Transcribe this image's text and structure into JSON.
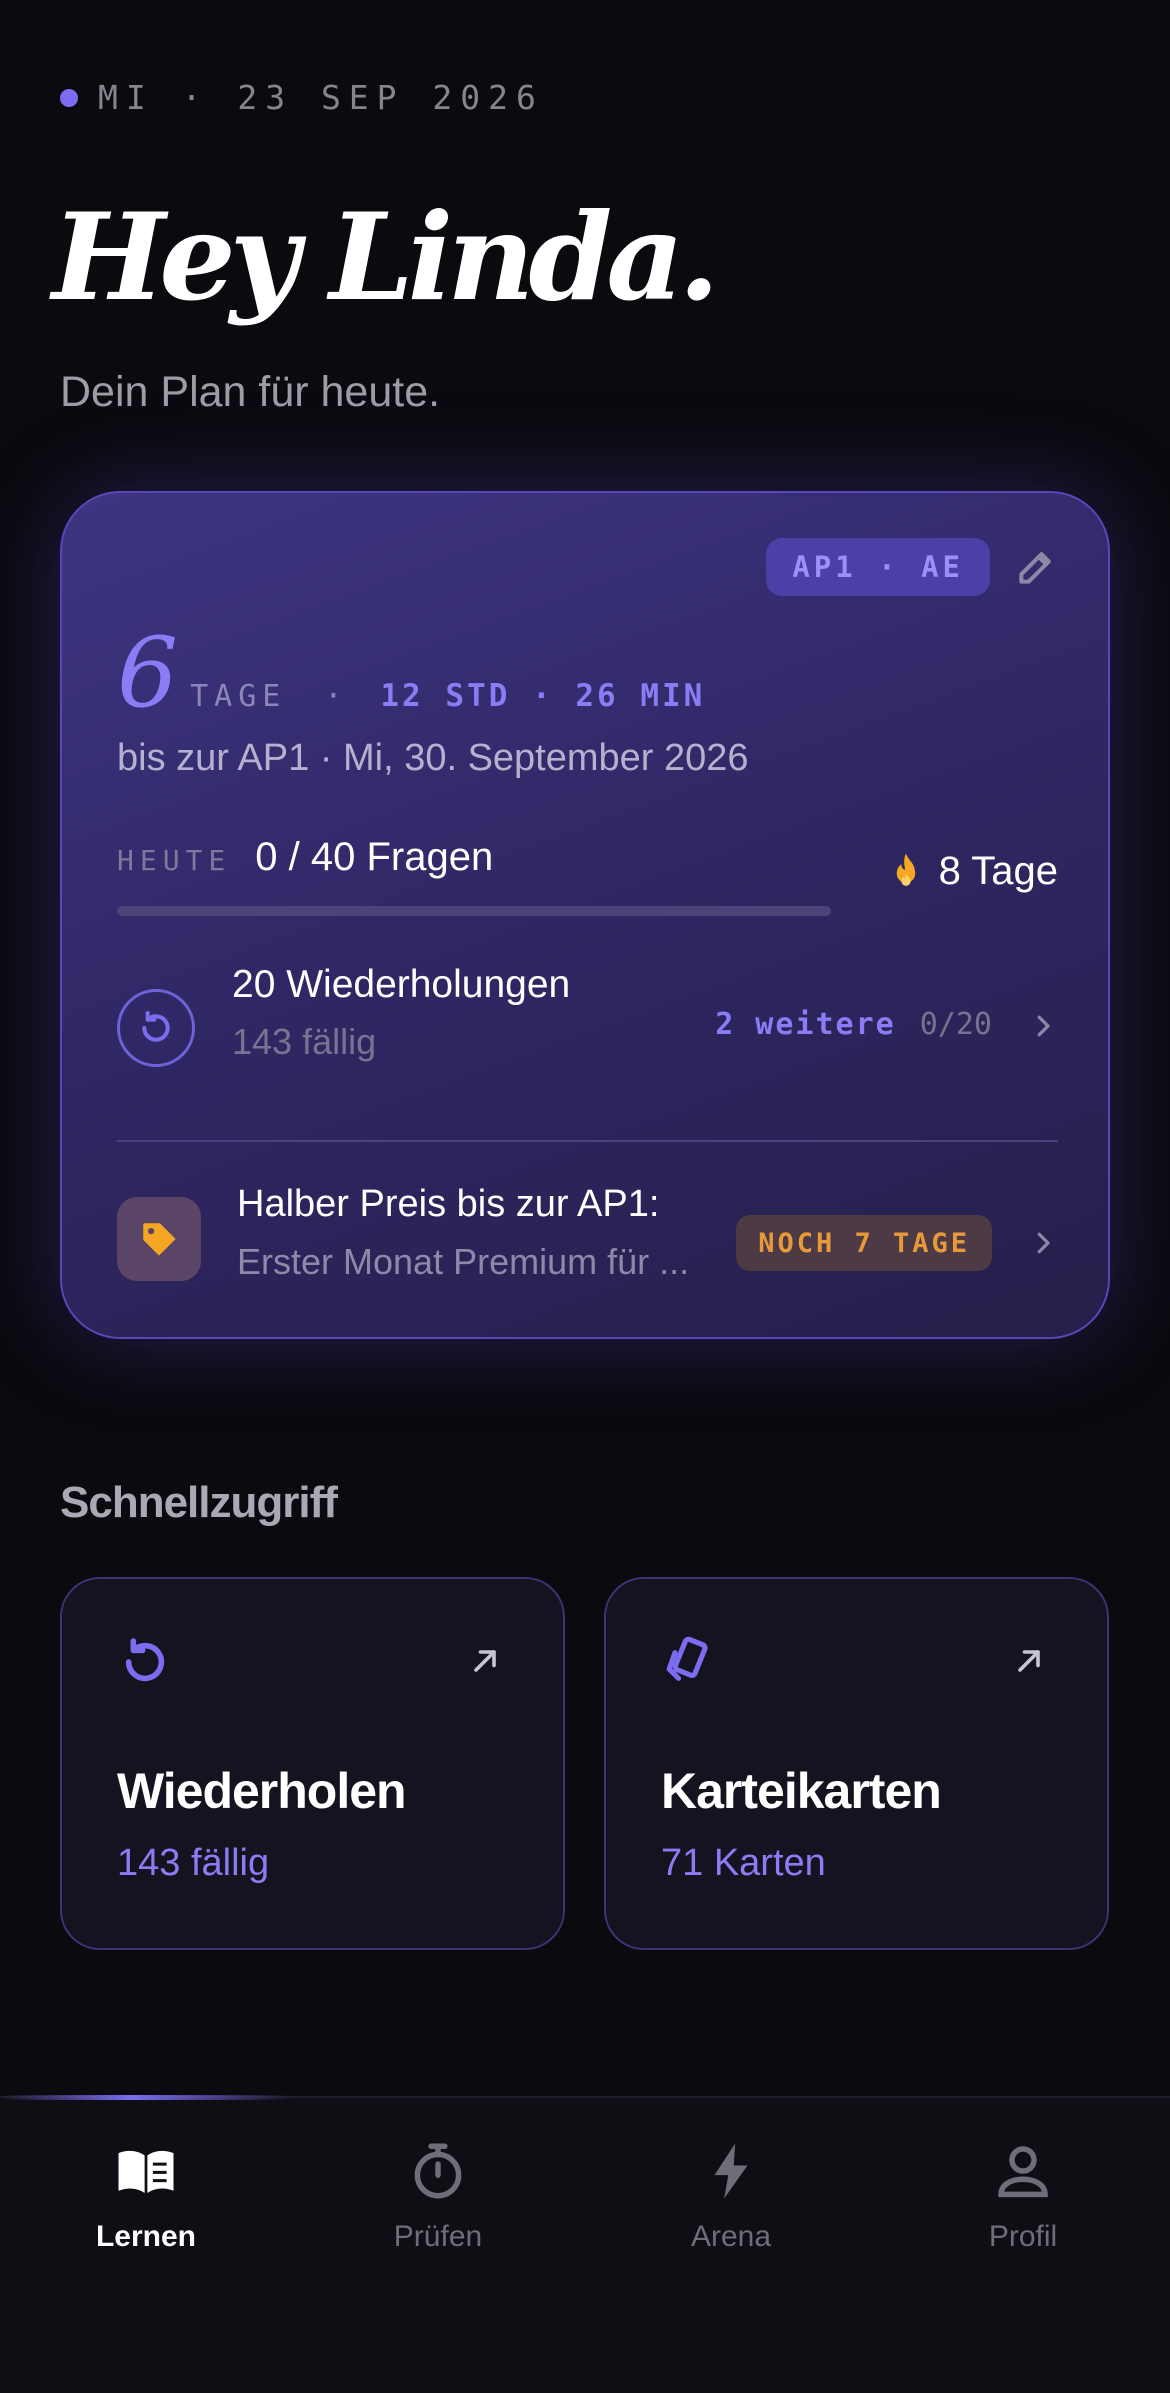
{
  "header": {
    "date": "MI · 23 SEP 2026",
    "greeting": "Hey Linda.",
    "subtitle": "Dein Plan für heute."
  },
  "plan": {
    "badge": "AP1 · AE",
    "countdown_days": "6",
    "countdown_unit": "TAGE",
    "countdown_separator": "·",
    "countdown_time": "12 STD · 26 MIN",
    "deadline": "bis zur AP1 · Mi, 30. September 2026",
    "today_label": "HEUTE",
    "today_value": "0 / 40 Fragen",
    "progress": 0,
    "streak": "8 Tage",
    "review_title": "20 Wiederholungen",
    "review_sub": "143 fällig",
    "review_more": "2 weitere",
    "review_count": "0/20",
    "promo_title": "Halber Preis bis zur AP1:",
    "promo_sub": "Erster Monat Premium für ...",
    "promo_badge": "NOCH 7 TAGE"
  },
  "quick_access": {
    "title": "Schnellzugriff",
    "cards": [
      {
        "title": "Wiederholen",
        "sub": "143 fällig",
        "icon": "refresh-icon"
      },
      {
        "title": "Karteikarten",
        "sub": "71 Karten",
        "icon": "cards-icon"
      }
    ]
  },
  "tabs": [
    {
      "label": "Lernen",
      "icon": "book-icon",
      "active": true
    },
    {
      "label": "Prüfen",
      "icon": "stopwatch-icon",
      "active": false
    },
    {
      "label": "Arena",
      "icon": "lightning-icon",
      "active": false
    },
    {
      "label": "Profil",
      "icon": "person-icon",
      "active": false
    }
  ],
  "colors": {
    "accent": "#8b7cf6",
    "background": "#0a0a0f",
    "warning": "#f5a623"
  }
}
